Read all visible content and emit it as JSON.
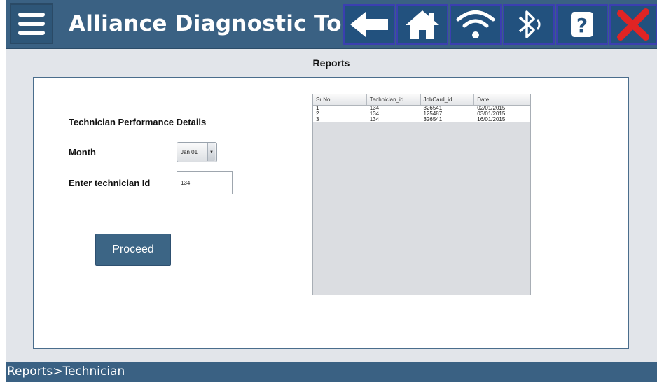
{
  "header": {
    "title": "Alliance Diagnostic Tool",
    "icons": [
      "menu-icon",
      "back-arrow-icon",
      "home-icon",
      "wifi-icon",
      "bluetooth-icon",
      "help-icon",
      "close-icon"
    ],
    "accent_color": "#3a6183"
  },
  "page": {
    "title": "Reports"
  },
  "form": {
    "section_title": "Technician Performance Details",
    "month_label": "Month",
    "month_value": "Jan 01",
    "tech_label": "Enter technician Id",
    "tech_value": "134",
    "proceed_label": "Proceed"
  },
  "table": {
    "columns": [
      "Sr No",
      "Technician_id",
      "JobCard_id",
      "Date"
    ],
    "rows": [
      [
        "1",
        "134",
        "326541",
        "02/01/2015"
      ],
      [
        "2",
        "134",
        "125487",
        "03/01/2015"
      ],
      [
        "3",
        "134",
        "326541",
        "16/01/2015"
      ]
    ]
  },
  "footer": {
    "breadcrumb": "Reports>Technician"
  }
}
